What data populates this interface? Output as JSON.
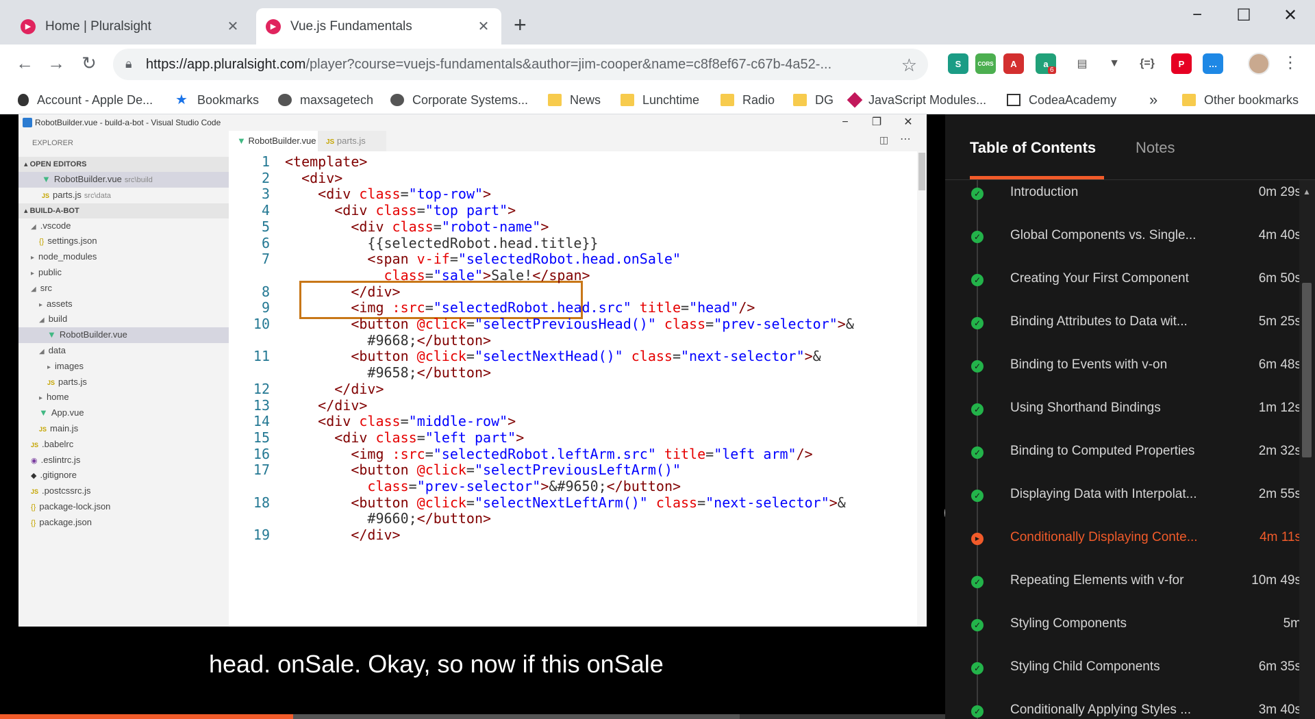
{
  "browser": {
    "tabs": [
      {
        "title": "Home | Pluralsight",
        "active": false
      },
      {
        "title": "Vue.js Fundamentals",
        "active": true
      }
    ],
    "url_host": "https://app.pluralsight.com",
    "url_path": "/player?course=vuejs-fundamentals&author=jim-cooper&name=c8f8ef67-c67b-4a52-...",
    "extensions": [
      {
        "name": "s-icon",
        "label": "S",
        "color": "#1b9c85"
      },
      {
        "name": "cors-icon",
        "label": "CORS",
        "color": "#4caf50"
      },
      {
        "name": "pdf-icon",
        "label": "A",
        "color": "#d32f2f"
      },
      {
        "name": "a-icon",
        "label": "a",
        "color": "#21a179"
      },
      {
        "name": "comment-icon",
        "label": "▤",
        "color": "#8a8a8a"
      },
      {
        "name": "v-icon",
        "label": "▼",
        "color": "#8a8a8a"
      },
      {
        "name": "json-icon",
        "label": "{=}",
        "color": "#ffffff"
      },
      {
        "name": "pinterest-icon",
        "label": "P",
        "color": "#e60023"
      },
      {
        "name": "messenger-icon",
        "label": "…",
        "color": "#1e88e5"
      }
    ],
    "extension_badge": "6"
  },
  "bookmarks": [
    {
      "label": "Account - Apple De...",
      "icon": "apple-icon"
    },
    {
      "label": "Bookmarks",
      "icon": "star-icon"
    },
    {
      "label": "maxsagetech",
      "icon": "globe-icon"
    },
    {
      "label": "Corporate Systems...",
      "icon": "globe-icon"
    },
    {
      "label": "News",
      "icon": "folder-icon"
    },
    {
      "label": "Lunchtime",
      "icon": "folder-icon"
    },
    {
      "label": "Radio",
      "icon": "folder-icon"
    },
    {
      "label": "DG",
      "icon": "folder-icon"
    },
    {
      "label": "JavaScript Modules...",
      "icon": "modules-icon"
    },
    {
      "label": "CodeaAcademy",
      "icon": "codea-icon"
    }
  ],
  "bookmarks_more": "»",
  "bookmarks_other": "Other bookmarks",
  "vscode": {
    "window_title": "RobotBuilder.vue - build-a-bot - Visual Studio Code",
    "explorer_title": "EXPLORER",
    "open_editors_title": "OPEN EDITORS",
    "open_editors": [
      {
        "name": "RobotBuilder.vue",
        "path": "src\\build",
        "type": "vue",
        "selected": true
      },
      {
        "name": "parts.js",
        "path": "src\\data",
        "type": "js",
        "selected": false
      }
    ],
    "project_title": "BUILD-A-BOT",
    "tree": [
      {
        "name": ".vscode",
        "indent": 1,
        "kind": "open-folder"
      },
      {
        "name": "settings.json",
        "indent": 2,
        "kind": "json"
      },
      {
        "name": "node_modules",
        "indent": 1,
        "kind": "folder"
      },
      {
        "name": "public",
        "indent": 1,
        "kind": "folder"
      },
      {
        "name": "src",
        "indent": 1,
        "kind": "open-folder"
      },
      {
        "name": "assets",
        "indent": 2,
        "kind": "folder"
      },
      {
        "name": "build",
        "indent": 2,
        "kind": "open-folder"
      },
      {
        "name": "RobotBuilder.vue",
        "indent": 3,
        "kind": "vue",
        "selected": true
      },
      {
        "name": "data",
        "indent": 2,
        "kind": "open-folder"
      },
      {
        "name": "images",
        "indent": 3,
        "kind": "folder"
      },
      {
        "name": "parts.js",
        "indent": 3,
        "kind": "js"
      },
      {
        "name": "home",
        "indent": 2,
        "kind": "folder"
      },
      {
        "name": "App.vue",
        "indent": 2,
        "kind": "vue"
      },
      {
        "name": "main.js",
        "indent": 2,
        "kind": "js"
      },
      {
        "name": ".babelrc",
        "indent": 1,
        "kind": "js"
      },
      {
        "name": ".eslintrc.js",
        "indent": 1,
        "kind": "eslint"
      },
      {
        "name": ".gitignore",
        "indent": 1,
        "kind": "git"
      },
      {
        "name": ".postcssrc.js",
        "indent": 1,
        "kind": "js"
      },
      {
        "name": "package-lock.json",
        "indent": 1,
        "kind": "json"
      },
      {
        "name": "package.json",
        "indent": 1,
        "kind": "json"
      }
    ],
    "editor_tabs": [
      {
        "name": "RobotBuilder.vue",
        "active": true
      },
      {
        "name": "parts.js",
        "active": false
      }
    ],
    "code_lines": [
      {
        "n": "1",
        "segs": [
          [
            "t",
            "<template>"
          ]
        ]
      },
      {
        "n": "2",
        "segs": [
          [
            "p",
            "  "
          ],
          [
            "t",
            "<div>"
          ]
        ]
      },
      {
        "n": "3",
        "segs": [
          [
            "p",
            "    "
          ],
          [
            "t",
            "<div "
          ],
          [
            "a",
            "class"
          ],
          [
            "p",
            "="
          ],
          [
            "s",
            "\"top-row\""
          ],
          [
            "t",
            ">"
          ]
        ]
      },
      {
        "n": "4",
        "segs": [
          [
            "p",
            "      "
          ],
          [
            "t",
            "<div "
          ],
          [
            "a",
            "class"
          ],
          [
            "p",
            "="
          ],
          [
            "s",
            "\"top part\""
          ],
          [
            "t",
            ">"
          ]
        ]
      },
      {
        "n": "5",
        "segs": [
          [
            "p",
            "        "
          ],
          [
            "t",
            "<div "
          ],
          [
            "a",
            "class"
          ],
          [
            "p",
            "="
          ],
          [
            "s",
            "\"robot-name\""
          ],
          [
            "t",
            ">"
          ]
        ]
      },
      {
        "n": "6",
        "segs": [
          [
            "p",
            "          {{selectedRobot.head.title}}"
          ]
        ]
      },
      {
        "n": "7",
        "segs": [
          [
            "p",
            "          "
          ],
          [
            "t",
            "<span "
          ],
          [
            "a",
            "v-if"
          ],
          [
            "p",
            "="
          ],
          [
            "s",
            "\"selectedRobot.head.onSale\""
          ]
        ]
      },
      {
        "n": "",
        "segs": [
          [
            "p",
            "            "
          ],
          [
            "a",
            "class"
          ],
          [
            "p",
            "="
          ],
          [
            "s",
            "\"sale\""
          ],
          [
            "t",
            ">"
          ],
          [
            "p",
            "Sale!"
          ],
          [
            "t",
            "</span>"
          ]
        ]
      },
      {
        "n": "8",
        "segs": [
          [
            "p",
            "        "
          ],
          [
            "t",
            "</div>"
          ]
        ]
      },
      {
        "n": "9",
        "segs": [
          [
            "p",
            "        "
          ],
          [
            "t",
            "<img "
          ],
          [
            "a",
            ":src"
          ],
          [
            "p",
            "="
          ],
          [
            "s",
            "\"selectedRobot.head.src\" "
          ],
          [
            "a",
            "title"
          ],
          [
            "p",
            "="
          ],
          [
            "s",
            "\"head\""
          ],
          [
            "t",
            "/>"
          ]
        ]
      },
      {
        "n": "10",
        "segs": [
          [
            "p",
            "        "
          ],
          [
            "t",
            "<button "
          ],
          [
            "a",
            "@click"
          ],
          [
            "p",
            "="
          ],
          [
            "s",
            "\"selectPreviousHead()\" "
          ],
          [
            "a",
            "class"
          ],
          [
            "p",
            "="
          ],
          [
            "s",
            "\"prev-selector\""
          ],
          [
            "t",
            ">"
          ],
          [
            "p",
            "&"
          ]
        ]
      },
      {
        "n": "",
        "segs": [
          [
            "p",
            "          #9668;"
          ],
          [
            "t",
            "</button>"
          ]
        ]
      },
      {
        "n": "11",
        "segs": [
          [
            "p",
            "        "
          ],
          [
            "t",
            "<button "
          ],
          [
            "a",
            "@click"
          ],
          [
            "p",
            "="
          ],
          [
            "s",
            "\"selectNextHead()\" "
          ],
          [
            "a",
            "class"
          ],
          [
            "p",
            "="
          ],
          [
            "s",
            "\"next-selector\""
          ],
          [
            "t",
            ">"
          ],
          [
            "p",
            "&"
          ]
        ]
      },
      {
        "n": "",
        "segs": [
          [
            "p",
            "          #9658;"
          ],
          [
            "t",
            "</button>"
          ]
        ]
      },
      {
        "n": "12",
        "segs": [
          [
            "p",
            "      "
          ],
          [
            "t",
            "</div>"
          ]
        ]
      },
      {
        "n": "13",
        "segs": [
          [
            "p",
            "    "
          ],
          [
            "t",
            "</div>"
          ]
        ]
      },
      {
        "n": "14",
        "segs": [
          [
            "p",
            "    "
          ],
          [
            "t",
            "<div "
          ],
          [
            "a",
            "class"
          ],
          [
            "p",
            "="
          ],
          [
            "s",
            "\"middle-row\""
          ],
          [
            "t",
            ">"
          ]
        ]
      },
      {
        "n": "15",
        "segs": [
          [
            "p",
            "      "
          ],
          [
            "t",
            "<div "
          ],
          [
            "a",
            "class"
          ],
          [
            "p",
            "="
          ],
          [
            "s",
            "\"left part\""
          ],
          [
            "t",
            ">"
          ]
        ]
      },
      {
        "n": "16",
        "segs": [
          [
            "p",
            "        "
          ],
          [
            "t",
            "<img "
          ],
          [
            "a",
            ":src"
          ],
          [
            "p",
            "="
          ],
          [
            "s",
            "\"selectedRobot.leftArm.src\" "
          ],
          [
            "a",
            "title"
          ],
          [
            "p",
            "="
          ],
          [
            "s",
            "\"left arm\""
          ],
          [
            "t",
            "/>"
          ]
        ]
      },
      {
        "n": "17",
        "segs": [
          [
            "p",
            "        "
          ],
          [
            "t",
            "<button "
          ],
          [
            "a",
            "@click"
          ],
          [
            "p",
            "="
          ],
          [
            "s",
            "\"selectPreviousLeftArm()\""
          ]
        ]
      },
      {
        "n": "",
        "segs": [
          [
            "p",
            "          "
          ],
          [
            "a",
            "class"
          ],
          [
            "p",
            "="
          ],
          [
            "s",
            "\"prev-selector\""
          ],
          [
            "t",
            ">"
          ],
          [
            "p",
            "&#9650;"
          ],
          [
            "t",
            "</button>"
          ]
        ]
      },
      {
        "n": "18",
        "segs": [
          [
            "p",
            "        "
          ],
          [
            "t",
            "<button "
          ],
          [
            "a",
            "@click"
          ],
          [
            "p",
            "="
          ],
          [
            "s",
            "\"selectNextLeftArm()\" "
          ],
          [
            "a",
            "class"
          ],
          [
            "p",
            "="
          ],
          [
            "s",
            "\"next-selector\""
          ],
          [
            "t",
            ">"
          ],
          [
            "p",
            "&"
          ]
        ]
      },
      {
        "n": "",
        "segs": [
          [
            "p",
            "          #9660;"
          ],
          [
            "t",
            "</button>"
          ]
        ]
      },
      {
        "n": "19",
        "segs": [
          [
            "p",
            "        "
          ],
          [
            "t",
            "</div>"
          ]
        ]
      }
    ]
  },
  "caption": "head. onSale. Okay, so now if this onSale",
  "video_progress": 0.31,
  "toc": {
    "tab_contents": "Table of Contents",
    "tab_notes": "Notes",
    "items": [
      {
        "title": "Introduction",
        "duration": "0m 29s",
        "status": "done"
      },
      {
        "title": "Global Components vs. Single...",
        "duration": "4m 40s",
        "status": "done"
      },
      {
        "title": "Creating Your First Component",
        "duration": "6m 50s",
        "status": "done"
      },
      {
        "title": "Binding Attributes to Data wit...",
        "duration": "5m 25s",
        "status": "done"
      },
      {
        "title": "Binding to Events with v-on",
        "duration": "6m 48s",
        "status": "done"
      },
      {
        "title": "Using Shorthand Bindings",
        "duration": "1m 12s",
        "status": "done"
      },
      {
        "title": "Binding to Computed Properties",
        "duration": "2m 32s",
        "status": "done"
      },
      {
        "title": "Displaying Data with Interpolat...",
        "duration": "2m 55s",
        "status": "done"
      },
      {
        "title": "Conditionally Displaying Conte...",
        "duration": "4m 11s",
        "status": "current"
      },
      {
        "title": "Repeating Elements with v-for",
        "duration": "10m 49s",
        "status": "done"
      },
      {
        "title": "Styling Components",
        "duration": "5m",
        "status": "done"
      },
      {
        "title": "Styling Child Components",
        "duration": "6m 35s",
        "status": "done"
      },
      {
        "title": "Conditionally Applying Styles ...",
        "duration": "3m 40s",
        "status": "done"
      }
    ]
  },
  "colors": {
    "accent": "#f15b2a",
    "done": "#23b34a"
  }
}
